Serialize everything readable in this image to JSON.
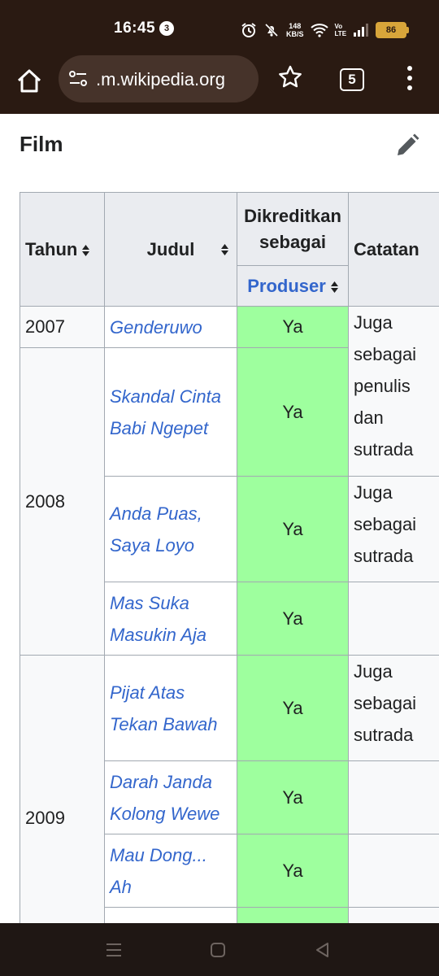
{
  "status": {
    "time": "16:45",
    "notification_count": "3",
    "net_speed_value": "148",
    "net_speed_unit": "KB/S",
    "volte_top": "Vo",
    "volte_bottom": "LTE",
    "battery": "86"
  },
  "browser": {
    "url": ".m.wikipedia.org",
    "tab_count": "5"
  },
  "page": {
    "section_title": "Film"
  },
  "table": {
    "col_tahun": "Tahun",
    "col_judul": "Judul",
    "col_dikreditkan": "Dikreditkan sebagai",
    "col_produser": "Produser",
    "col_catatan": "Catatan",
    "rows": [
      {
        "year": "2007",
        "title": "Genderuwo",
        "produser": "Ya"
      },
      {
        "year": "2008",
        "title_line1": "Skandal Cinta",
        "title_line2": "Babi Ngepet",
        "produser": "Ya"
      },
      {
        "title_line1": "Anda Puas,",
        "title_line2": "Saya Loyo",
        "produser": "Ya"
      },
      {
        "title_line1": "Mas Suka",
        "title_line2": "Masukin Aja",
        "produser": "Ya"
      },
      {
        "year": "2009",
        "title_line1": "Pijat Atas",
        "title_line2": "Tekan Bawah",
        "produser": "Ya"
      },
      {
        "title_line1": "Darah Janda",
        "title_line2": "Kolong Wewe",
        "produser": "Ya"
      },
      {
        "title_line1": "Mau Dong...",
        "title_line2": "Ah",
        "produser": "Ya"
      }
    ],
    "notes": {
      "n1": [
        "Juga",
        "sebagai",
        "penulis",
        "dan",
        "sutrada"
      ],
      "n2": [
        "Juga",
        "sebagai",
        "sutrada"
      ],
      "n3": [
        "Juga",
        "sebagai",
        "sutrada"
      ]
    }
  }
}
